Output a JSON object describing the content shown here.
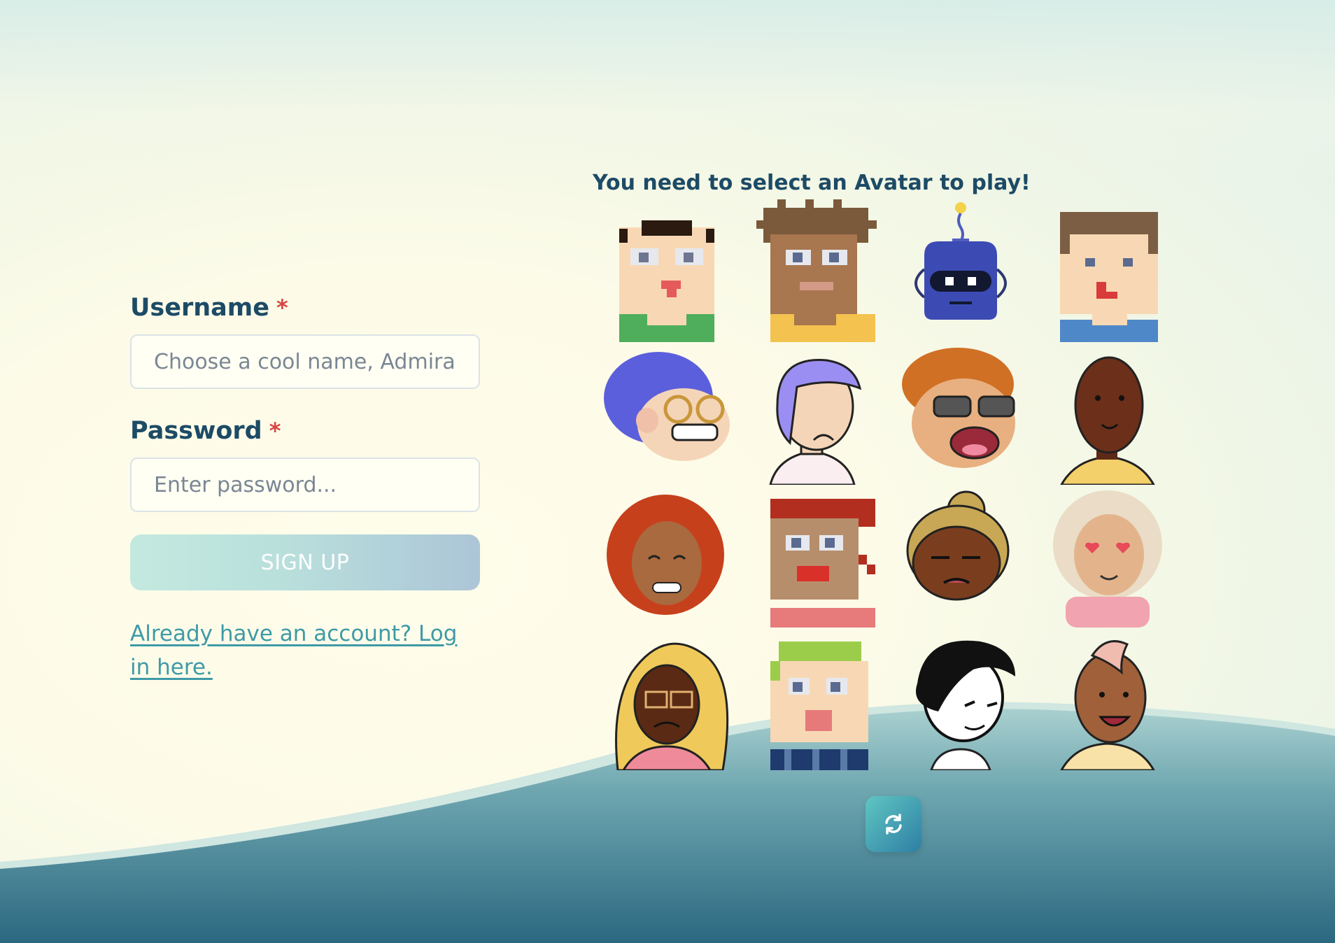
{
  "form": {
    "username": {
      "label": "Username",
      "required_mark": "*",
      "placeholder": "Choose a cool name, Admiral!",
      "value": ""
    },
    "password": {
      "label": "Password",
      "required_mark": "*",
      "placeholder": "Enter password...",
      "value": ""
    },
    "signup_label": "SIGN UP",
    "login_link": "Already have an account? Log in here."
  },
  "avatars": {
    "title": "You need to select an Avatar to play!",
    "refresh_icon": "refresh-icon"
  },
  "colors": {
    "heading": "#1d4b66",
    "required": "#d94545",
    "link": "#3f9aa7",
    "wave_dark": "#2b6880",
    "wave_light": "#9ccbcb"
  }
}
